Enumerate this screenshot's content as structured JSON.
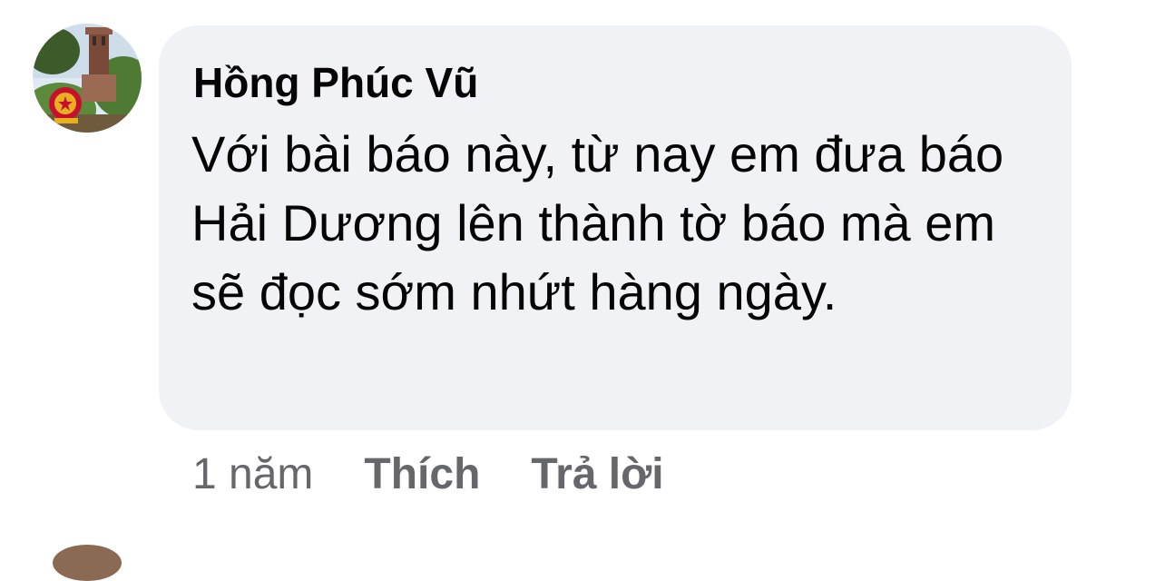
{
  "comment": {
    "author": "Hồng Phúc Vũ",
    "text": "Với bài báo này, từ nay em đưa báo Hải Dương lên thành tờ báo mà em sẽ đọc sớm nhứt hàng ngày.",
    "timestamp": "1 năm",
    "like_label": "Thích",
    "reply_label": "Trả lời",
    "avatar_icon": "tower-with-emblem-avatar"
  },
  "colors": {
    "bubble_background": "#f0f2f5",
    "text_primary": "#050505",
    "text_secondary": "#65676b"
  }
}
